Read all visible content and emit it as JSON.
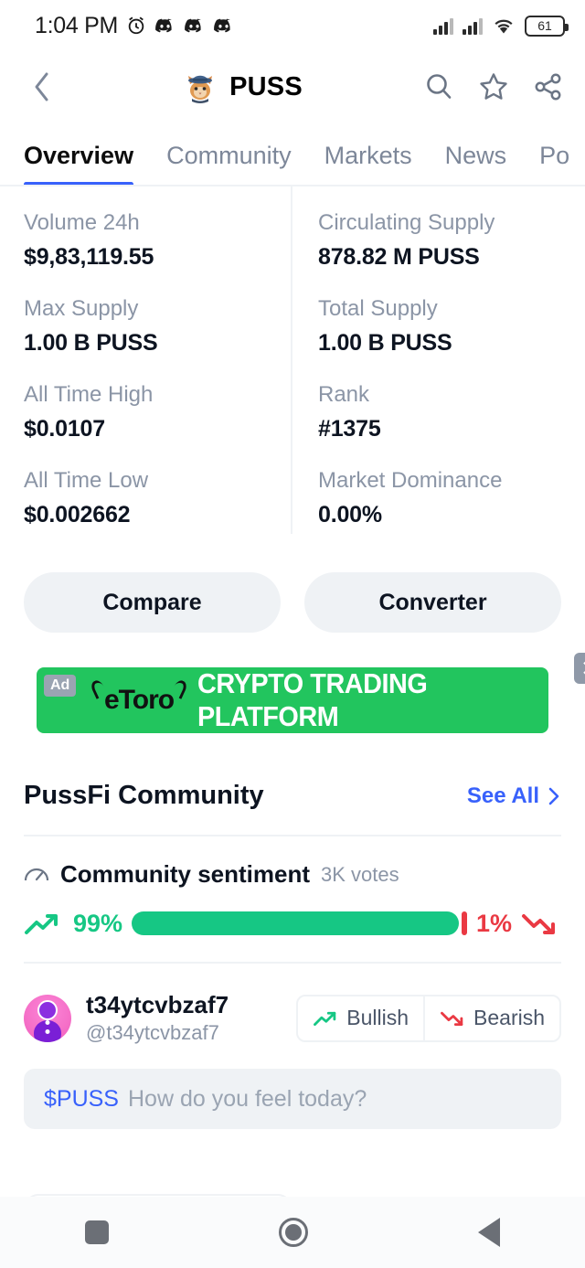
{
  "status_bar": {
    "time": "1:04 PM",
    "alarm_icon": "alarm-icon",
    "discord_icons": [
      "discord-icon",
      "discord-icon",
      "discord-icon"
    ],
    "signal_icons": [
      "signal-bars-icon",
      "signal-bars-icon"
    ],
    "wifi_icon": "wifi-icon",
    "battery_level": "61"
  },
  "header": {
    "back_icon": "chevron-left-icon",
    "logo_icon": "cat-with-hat-icon",
    "title": "PUSS",
    "search_icon": "search-icon",
    "favorite_icon": "star-icon",
    "share_icon": "share-icon"
  },
  "tabs": [
    {
      "label": "Overview",
      "active": true
    },
    {
      "label": "Community",
      "active": false
    },
    {
      "label": "Markets",
      "active": false
    },
    {
      "label": "News",
      "active": false
    },
    {
      "label": "Po",
      "active": false
    }
  ],
  "stats": {
    "left": [
      {
        "label": "Volume 24h",
        "value": "$9,83,119.55"
      },
      {
        "label": "Max Supply",
        "value": "1.00 B PUSS"
      },
      {
        "label": "All Time High",
        "value": "$0.0107"
      },
      {
        "label": "All Time Low",
        "value": "$0.002662"
      }
    ],
    "right": [
      {
        "label": "Circulating Supply",
        "value": "878.82 M PUSS"
      },
      {
        "label": "Total Supply",
        "value": "1.00 B PUSS"
      },
      {
        "label": "Rank",
        "value": "#1375"
      },
      {
        "label": "Market Dominance",
        "value": "0.00%"
      }
    ]
  },
  "actions": {
    "compare_label": "Compare",
    "converter_label": "Converter"
  },
  "ad": {
    "badge": "Ad",
    "brand": "eToro",
    "headline": "CRYPTO TRADING PLATFORM",
    "close_icon": "close-icon",
    "background_color": "#22c55e"
  },
  "community": {
    "section_title": "PussFi Community",
    "see_all_label": "See All",
    "see_all_icon": "chevron-right-icon",
    "sentiment": {
      "gauge_icon": "gauge-icon",
      "title": "Community sentiment",
      "votes": "3K votes",
      "bullish_percent": "99%",
      "bearish_percent": "1%",
      "bullish_value": 99,
      "bearish_value": 1,
      "bullish_color": "#16c784",
      "bearish_color": "#ea3943",
      "trend_up_icon": "trending-up-icon",
      "trend_down_icon": "trending-down-icon"
    },
    "user": {
      "avatar_icon": "user-avatar",
      "name": "t34ytcvbzaf7",
      "handle": "@t34ytcvbzaf7",
      "bullish_label": "Bullish",
      "bearish_label": "Bearish",
      "bullish_icon": "trending-up-icon",
      "bearish_icon": "trending-down-icon"
    },
    "post_input": {
      "cashtag": "$PUSS",
      "placeholder": "How do you feel today?"
    }
  },
  "nav_bar": {
    "recents_icon": "square-icon",
    "home_icon": "circle-icon",
    "back_icon": "triangle-back-icon"
  }
}
